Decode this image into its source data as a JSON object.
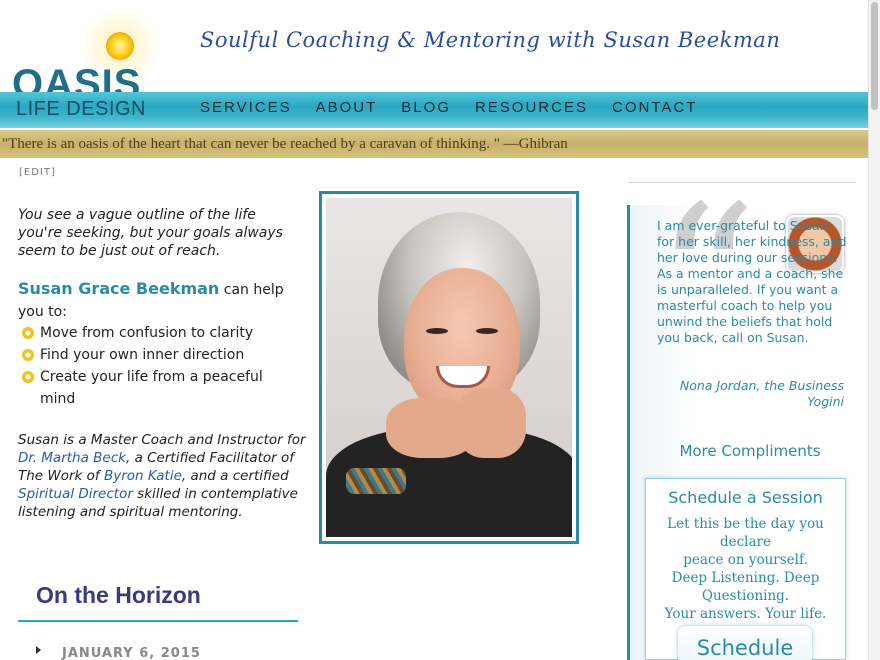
{
  "header": {
    "logo_word": "OASIS",
    "logo_sub": "LIFE DESIGN",
    "tagline": "Soulful Coaching & Mentoring with Susan Beekman"
  },
  "nav": [
    "SERVICES",
    "ABOUT",
    "BLOG",
    "RESOURCES",
    "CONTACT"
  ],
  "quote": "\"There is an oasis of the heart that can never be reached by a caravan of thinking. \" —Ghibran",
  "edit_label": "[EDIT]",
  "main": {
    "intro": "You see a vague outline of the life you're seeking, but your goals always seem to be just out of reach.",
    "name": "Susan Grace Beekman",
    "can_help": " can help you to:",
    "bullets": [
      "Move from confusion to clarity",
      "Find your own inner direction",
      "Create your life from a peaceful mind"
    ],
    "bio": {
      "p1": "Susan is a Master Coach and Instructor for ",
      "link1": "Dr. Martha Beck",
      "p2": ", a Certified Facilitator of The Work of ",
      "link2": "Byron Katie",
      "p3": ", and a certified ",
      "link3": "Spiritual Director",
      "p4": " skilled in contemplative listening and spiritual mentoring."
    },
    "horizon_title": "On the Horizon",
    "first_date": "JANUARY 6, 2015"
  },
  "sidebar": {
    "quote_mark": "“",
    "testimonial": "I am ever-grateful to Susan for her skill, her kindness, and her love during our sessions. As a mentor and a coach, she is unparalleled. If you want a masterful coach to help you unwind the beliefs that hold you back, call on Susan.",
    "attribution": "Nona Jordan, the Business Yogini",
    "more_link": "More Compliments",
    "schedule": {
      "title": "Schedule a Session",
      "text_lines": [
        "Let this be the day you declare",
        "peace on yourself.",
        "Deep Listening. Deep",
        "Questioning.",
        "Your answers. Your life."
      ],
      "button": "Schedule"
    }
  },
  "colors": {
    "accent": "#2a8ba6",
    "nav_band": "#2aa7c1",
    "quote_band": "#c9b06a",
    "horizon_title": "#3b3a7c",
    "link": "#2a5aa6"
  }
}
